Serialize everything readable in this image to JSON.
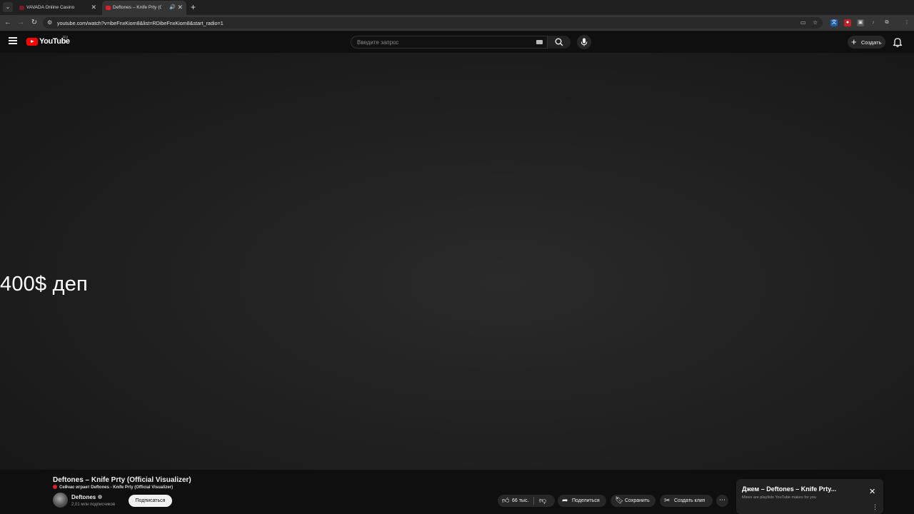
{
  "browser": {
    "tabs": [
      {
        "title": "VAVADA Online Casino",
        "active": false
      },
      {
        "title": "Deftones – Knife Prty (Offic",
        "active": true
      }
    ],
    "url": "youtube.com/watch?v=ibeFnxKiom8&list=RDibeFnxKiom8&start_radio=1"
  },
  "masthead": {
    "logo_text": "YouTube",
    "country": "RU",
    "search_placeholder": "Введите запрос",
    "create_label": "Создать"
  },
  "video": {
    "overlay_text": "400$ деп"
  },
  "info": {
    "title": "Deftones – Knife Prty (Official Visualizer)",
    "now_playing": "Сейчас играет Deftones - Knife Prty (Official Visualizer)",
    "channel": "Deftones",
    "subscribers": "2,01 млн подписчиков",
    "subscribe_label": "Подписаться",
    "likes": "66 тыс.",
    "share_label": "Поделиться",
    "save_label": "Сохранить",
    "clip_label": "Создать клип"
  },
  "mix_card": {
    "title": "Джем – Deftones – Knife Prty...",
    "subtitle": "Mixes are playlists YouTube makes for you"
  },
  "colors": {
    "brand_red": "#ff0000",
    "background": "#0f0f0f",
    "pill": "#272727"
  }
}
